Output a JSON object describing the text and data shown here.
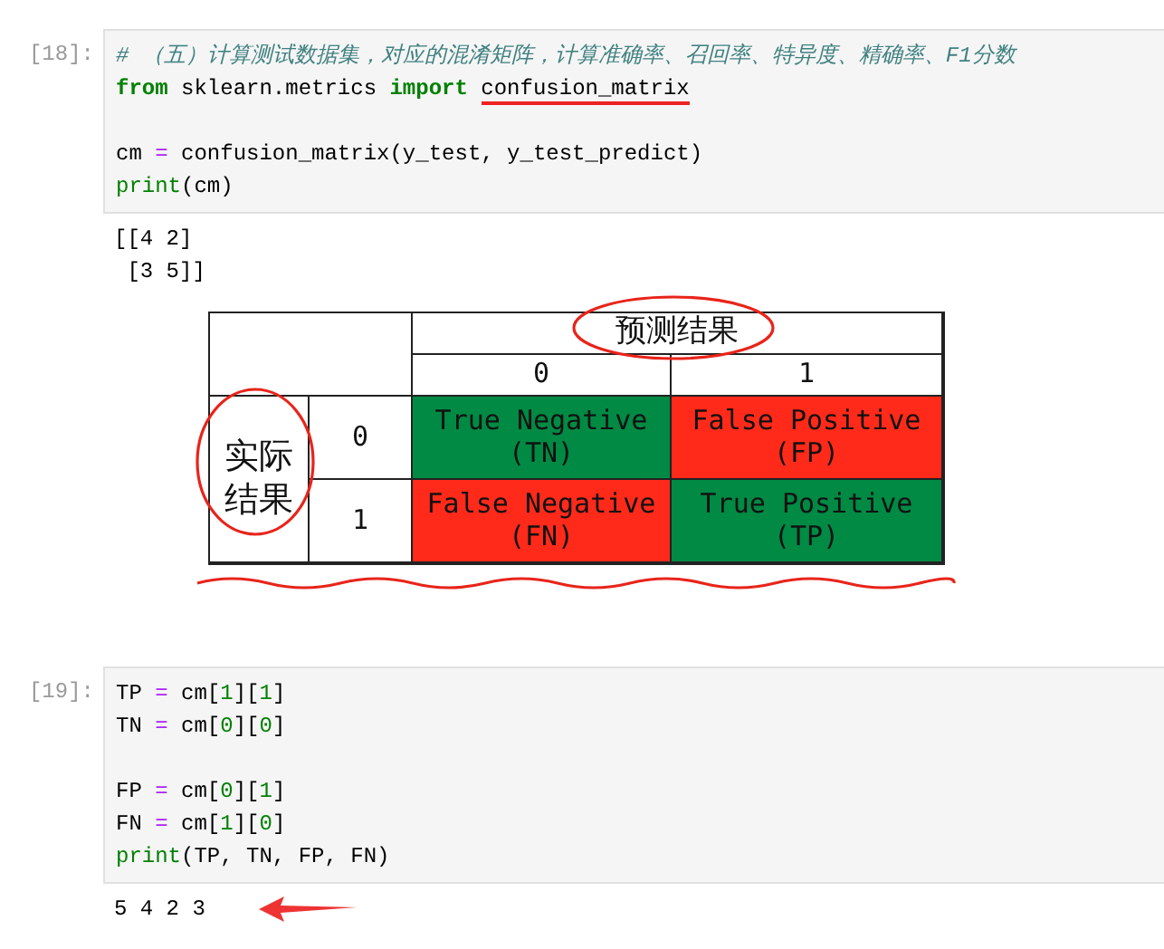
{
  "cells": [
    {
      "prompt": "[18]:",
      "input_lines": [
        {
          "kind": "code",
          "tokens": [
            {
              "text": "# （五）计算测试数据集，对应的混淆矩阵，计算准确率、召回率、特异度、精确率、F1分数",
              "kind": "comment"
            }
          ]
        },
        {
          "kind": "code",
          "tokens": [
            {
              "text": "from",
              "kind": "keyword"
            },
            {
              "text": " sklearn.metrics ",
              "kind": "plain"
            },
            {
              "text": "import ",
              "kind": "keyword"
            },
            {
              "text": "confusion_matrix",
              "kind": "plain",
              "underlined": true
            }
          ]
        },
        {
          "kind": "blank"
        },
        {
          "kind": "code",
          "tokens": [
            {
              "text": "cm ",
              "kind": "plain"
            },
            {
              "text": "=",
              "kind": "operator"
            },
            {
              "text": " confusion_matrix(y_test, y_test_predict)",
              "kind": "plain"
            }
          ]
        },
        {
          "kind": "code",
          "tokens": [
            {
              "text": "print",
              "kind": "builtin"
            },
            {
              "text": "(cm)",
              "kind": "plain"
            }
          ]
        }
      ],
      "output_lines": [
        "[[4 2]",
        " [3 5]]"
      ],
      "figure": {
        "header": "预测结果",
        "column_labels": [
          "0",
          "1"
        ],
        "row_header": "实际结果",
        "row_labels": [
          "0",
          "1"
        ],
        "rows": [
          [
            {
              "label": "True Negative",
              "abbr": "(TN)",
              "color": "#008a44"
            },
            {
              "label": "False Positive",
              "abbr": "(FP)",
              "color": "#ff2a1a"
            }
          ],
          [
            {
              "label": "False Negative",
              "abbr": "(FN)",
              "color": "#ff2a1a"
            },
            {
              "label": "True Positive",
              "abbr": "(TP)",
              "color": "#008a44"
            }
          ]
        ]
      }
    },
    {
      "prompt": "[19]:",
      "input_lines": [
        {
          "kind": "code",
          "tokens": [
            {
              "text": "TP ",
              "kind": "plain"
            },
            {
              "text": "=",
              "kind": "operator"
            },
            {
              "text": " cm[",
              "kind": "plain"
            },
            {
              "text": "1",
              "kind": "number"
            },
            {
              "text": "][",
              "kind": "plain"
            },
            {
              "text": "1",
              "kind": "number"
            },
            {
              "text": "]",
              "kind": "plain"
            }
          ]
        },
        {
          "kind": "code",
          "tokens": [
            {
              "text": "TN ",
              "kind": "plain"
            },
            {
              "text": "=",
              "kind": "operator"
            },
            {
              "text": " cm[",
              "kind": "plain"
            },
            {
              "text": "0",
              "kind": "number"
            },
            {
              "text": "][",
              "kind": "plain"
            },
            {
              "text": "0",
              "kind": "number"
            },
            {
              "text": "]",
              "kind": "plain"
            }
          ]
        },
        {
          "kind": "blank"
        },
        {
          "kind": "code",
          "tokens": [
            {
              "text": "FP ",
              "kind": "plain"
            },
            {
              "text": "=",
              "kind": "operator"
            },
            {
              "text": " cm[",
              "kind": "plain"
            },
            {
              "text": "0",
              "kind": "number"
            },
            {
              "text": "][",
              "kind": "plain"
            },
            {
              "text": "1",
              "kind": "number"
            },
            {
              "text": "]",
              "kind": "plain"
            }
          ]
        },
        {
          "kind": "code",
          "tokens": [
            {
              "text": "FN ",
              "kind": "plain"
            },
            {
              "text": "=",
              "kind": "operator"
            },
            {
              "text": " cm[",
              "kind": "plain"
            },
            {
              "text": "1",
              "kind": "number"
            },
            {
              "text": "][",
              "kind": "plain"
            },
            {
              "text": "0",
              "kind": "number"
            },
            {
              "text": "]",
              "kind": "plain"
            }
          ]
        },
        {
          "kind": "code",
          "tokens": [
            {
              "text": "print",
              "kind": "builtin"
            },
            {
              "text": "(TP, TN, FP, FN)",
              "kind": "plain"
            }
          ]
        }
      ],
      "output_lines": [
        "5 4 2 3"
      ],
      "output_arrow": true
    }
  ]
}
